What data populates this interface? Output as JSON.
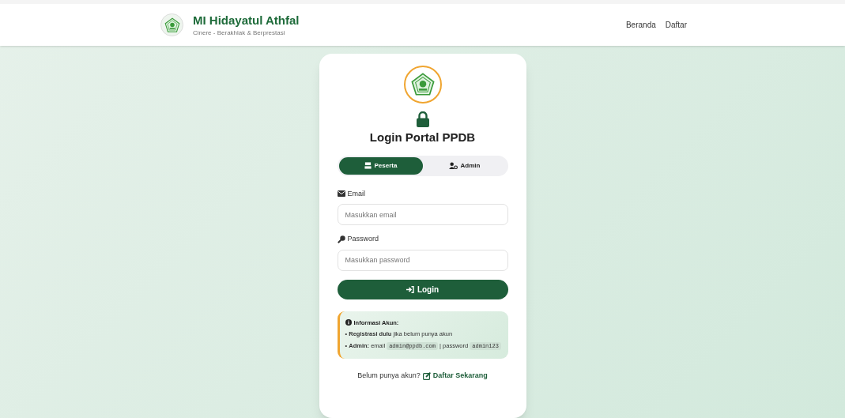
{
  "header": {
    "school_name": "MI Hidayatul Athfal",
    "tagline": "Cinere - Berakhlak & Berprestasi",
    "nav": [
      "Beranda",
      "Daftar"
    ]
  },
  "card": {
    "title": "Login Portal PPDB",
    "tabs": [
      {
        "label": "Peserta",
        "kind": "student",
        "selected": true
      },
      {
        "label": "Admin",
        "kind": "admin",
        "selected": false
      }
    ],
    "fields": [
      {
        "label": "Email",
        "kind": "email",
        "placeholder": "Masukkan email"
      },
      {
        "label": "Password",
        "kind": "password",
        "placeholder": "Masukkan password"
      }
    ],
    "login_button": "Login",
    "info": {
      "title": "Informasi Akun:",
      "lines": [
        [
          {
            "kind": "text",
            "text": "• **Registrasi dulu** jika belum punya akun"
          }
        ],
        [
          {
            "kind": "text",
            "text": "• **Admin:** email "
          },
          {
            "kind": "code",
            "text": "admin@ppdb.com"
          },
          {
            "kind": "text",
            "text": " | password "
          },
          {
            "kind": "code",
            "text": "admin123"
          }
        ]
      ]
    },
    "footer": {
      "question": "Belum punya akun?",
      "link": "Daftar Sekarang"
    }
  }
}
